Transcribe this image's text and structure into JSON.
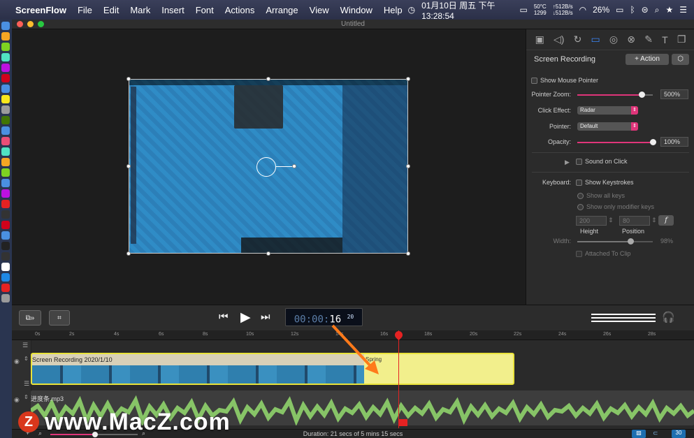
{
  "menubar": {
    "apple": "",
    "app_name": "ScreenFlow",
    "items": [
      "File",
      "Edit",
      "Mark",
      "Insert",
      "Font",
      "Actions",
      "Arrange",
      "View",
      "Window",
      "Help"
    ],
    "clock": "01月10日 周五 下午13:28:54",
    "temp_top": "50°C",
    "temp_bottom": "1299",
    "net_up": "512B/s",
    "net_down": "512B/s",
    "battery": "26%"
  },
  "window": {
    "title": "Untitled"
  },
  "inspector": {
    "section_title": "Screen Recording",
    "action_button": "+ Action",
    "show_mouse_pointer": "Show Mouse Pointer",
    "pointer_zoom_label": "Pointer Zoom:",
    "pointer_zoom_value": "500%",
    "pointer_zoom_level": 0.85,
    "click_effect_label": "Click Effect:",
    "click_effect_value": "Radar",
    "pointer_label": "Pointer:",
    "pointer_value": "Default",
    "opacity_label": "Opacity:",
    "opacity_value": "100%",
    "opacity_level": 1.0,
    "sound_on_click": "Sound on Click",
    "keyboard_label": "Keyboard:",
    "show_keystrokes": "Show Keystrokes",
    "show_all_keys": "Show all keys",
    "show_modifier_keys": "Show only modifier keys",
    "height_value": "200",
    "position_value": "80",
    "height_label": "Height",
    "position_label": "Position",
    "width_label": "Width:",
    "width_value": "98%",
    "width_level": 0.7,
    "attached_to_clip": "Attached To Clip"
  },
  "transport": {
    "timecode_dim": "00:00:",
    "timecode_bright": "16",
    "timecode_frames": "20"
  },
  "ruler": {
    "labels": [
      "0s",
      "2s",
      "4s",
      "6s",
      "8s",
      "10s",
      "12s",
      "14s",
      "16s",
      "18s",
      "20s",
      "22s",
      "24s",
      "26s",
      "28s"
    ]
  },
  "tracks": {
    "video_clip_label": "Screen Recording 2020/1/10",
    "video_sub_label": "Spring",
    "audio_clip_label": "进度条.mp3"
  },
  "status": {
    "duration": "Duration: 21 secs of 5 mins 15 secs"
  },
  "watermark": {
    "logo": "Z",
    "text": "www.MacZ.com"
  },
  "colors": {
    "accent": "#e0357a",
    "clip_border": "#e9e33a",
    "playhead": "#e52222",
    "waveform": "#8fd36b"
  }
}
